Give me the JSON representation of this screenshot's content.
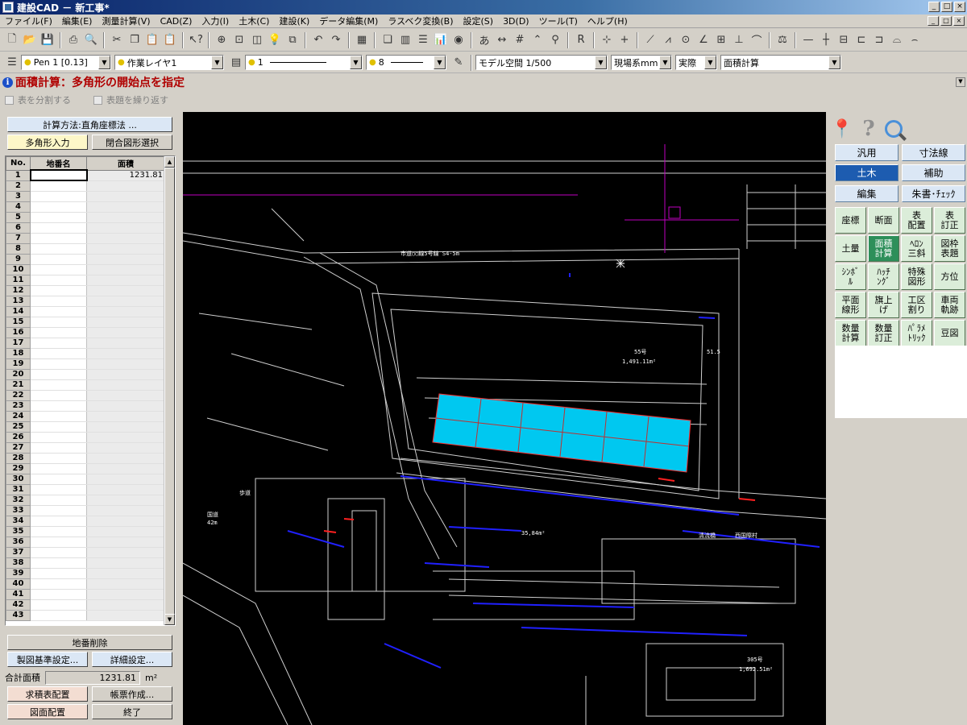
{
  "window": {
    "title": "建設CAD － 新工事*",
    "btn_min": "_",
    "btn_max": "□",
    "btn_close": "×"
  },
  "menu": [
    "ファイル(F)",
    "編集(E)",
    "測量計算(V)",
    "CAD(Z)",
    "入力(I)",
    "土木(C)",
    "建設(K)",
    "データ編集(M)",
    "ラスベク変換(B)",
    "設定(S)",
    "3D(D)",
    "ツール(T)",
    "ヘルプ(H)"
  ],
  "mdi_controls": [
    "_",
    "□",
    "×"
  ],
  "toolbar2": {
    "pen": "Pen 1 [0.13]",
    "layer": "作業レイヤ1",
    "linetype": "1",
    "linewidth": "8",
    "space": "モデル空間 1/500",
    "units": "現場系mm",
    "scale": "実際",
    "mode": "面積計算"
  },
  "prompt": {
    "text": "面積計算：多角形の開始点を指定"
  },
  "options": {
    "split_table": "表を分割する",
    "repeat_header": "表題を繰り返す"
  },
  "left": {
    "method_button": "計算方法:直角座標法 ...",
    "polygon_input": "多角形入力",
    "closed_select": "閉合図形選択",
    "columns": {
      "no": "No.",
      "name": "地番名",
      "area": "面積"
    },
    "rows": [
      {
        "no": "1",
        "name": "",
        "area": "1231.81"
      },
      {
        "no": "2",
        "name": "",
        "area": ""
      },
      {
        "no": "3",
        "name": "",
        "area": ""
      },
      {
        "no": "4",
        "name": "",
        "area": ""
      },
      {
        "no": "5",
        "name": "",
        "area": ""
      },
      {
        "no": "6",
        "name": "",
        "area": ""
      },
      {
        "no": "7",
        "name": "",
        "area": ""
      },
      {
        "no": "8",
        "name": "",
        "area": ""
      },
      {
        "no": "9",
        "name": "",
        "area": ""
      },
      {
        "no": "10",
        "name": "",
        "area": ""
      },
      {
        "no": "11",
        "name": "",
        "area": ""
      },
      {
        "no": "12",
        "name": "",
        "area": ""
      },
      {
        "no": "13",
        "name": "",
        "area": ""
      },
      {
        "no": "14",
        "name": "",
        "area": ""
      },
      {
        "no": "15",
        "name": "",
        "area": ""
      },
      {
        "no": "16",
        "name": "",
        "area": ""
      },
      {
        "no": "17",
        "name": "",
        "area": ""
      },
      {
        "no": "18",
        "name": "",
        "area": ""
      },
      {
        "no": "19",
        "name": "",
        "area": ""
      },
      {
        "no": "20",
        "name": "",
        "area": ""
      },
      {
        "no": "21",
        "name": "",
        "area": ""
      },
      {
        "no": "22",
        "name": "",
        "area": ""
      },
      {
        "no": "23",
        "name": "",
        "area": ""
      },
      {
        "no": "24",
        "name": "",
        "area": ""
      },
      {
        "no": "25",
        "name": "",
        "area": ""
      },
      {
        "no": "26",
        "name": "",
        "area": ""
      },
      {
        "no": "27",
        "name": "",
        "area": ""
      },
      {
        "no": "28",
        "name": "",
        "area": ""
      },
      {
        "no": "29",
        "name": "",
        "area": ""
      },
      {
        "no": "30",
        "name": "",
        "area": ""
      },
      {
        "no": "31",
        "name": "",
        "area": ""
      },
      {
        "no": "32",
        "name": "",
        "area": ""
      },
      {
        "no": "33",
        "name": "",
        "area": ""
      },
      {
        "no": "34",
        "name": "",
        "area": ""
      },
      {
        "no": "35",
        "name": "",
        "area": ""
      },
      {
        "no": "36",
        "name": "",
        "area": ""
      },
      {
        "no": "37",
        "name": "",
        "area": ""
      },
      {
        "no": "38",
        "name": "",
        "area": ""
      },
      {
        "no": "39",
        "name": "",
        "area": ""
      },
      {
        "no": "40",
        "name": "",
        "area": ""
      },
      {
        "no": "41",
        "name": "",
        "area": ""
      },
      {
        "no": "42",
        "name": "",
        "area": ""
      },
      {
        "no": "43",
        "name": "",
        "area": ""
      }
    ],
    "delete_lot": "地番削除",
    "drafting_settings": "製図基準設定...",
    "detail_settings": "詳細設定...",
    "total_label": "合計面積",
    "total_value": "1231.81",
    "total_unit": "m²",
    "place_table": "求積表配置",
    "create_report": "帳票作成...",
    "place_drawing": "図面配置",
    "finish": "終了"
  },
  "canvas": {
    "labels": [
      "市道○○線5号線 S4-5m",
      "55号",
      "1,491.11m²",
      "51.5",
      "35,84m²",
      "305号",
      "1,692.51m²",
      "清流橋",
      "西国際村",
      "国道",
      "42m",
      "歩道"
    ]
  },
  "right": {
    "categories": [
      "汎用",
      "寸法線",
      "土木",
      "補助",
      "編集",
      "朱書･ﾁｪｯｸ"
    ],
    "active_category": "土木",
    "commands": [
      "座標",
      "断面",
      "表\n配置",
      "表\n訂正",
      "土量",
      "面積\n計算",
      "ﾍﾛﾝ\n三斜",
      "図枠\n表題",
      "ｼﾝﾎﾞ\nﾙ",
      "ﾊｯﾁ\nﾝｸﾞ",
      "特殊\n図形",
      "方位",
      "平面\n線形",
      "旗上\nげ",
      "工区\n割り",
      "車両\n軌跡",
      "数量\n計算",
      "数量\n訂正",
      "ﾊﾟﾗﾒ\nﾄﾘｯｸ",
      "豆図"
    ],
    "active_command": "面積\n計算"
  },
  "colors": {
    "highlight": "#00c8f0",
    "prompt": "#b00000",
    "active_cat": "#1d5cb0",
    "active_cmd": "#2d8f5a"
  }
}
